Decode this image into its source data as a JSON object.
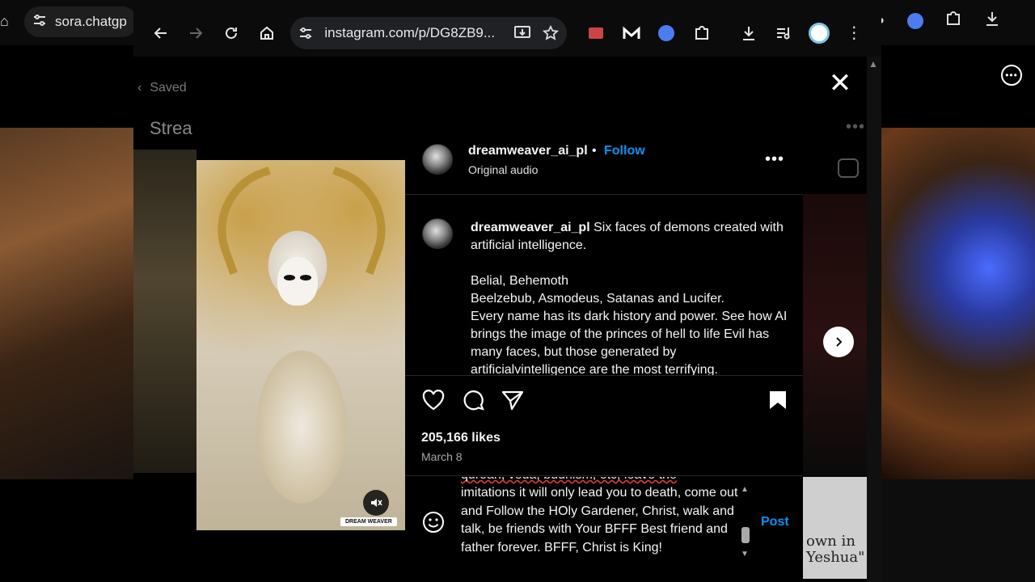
{
  "background_browser": {
    "tab_title": "sora.chatgp",
    "tab_icon": "tune-icon"
  },
  "browser": {
    "url": "instagram.com/p/DG8ZB9...",
    "buttons": [
      "back-icon",
      "forward-icon",
      "reload-icon",
      "home-icon"
    ],
    "extensions": [
      "install-app-icon",
      "bookmark-star-icon",
      "extension-icon",
      "m-extension-icon",
      "docs-icon",
      "puzzle-icon",
      "download-icon",
      "media-icon",
      "profile-icon",
      "menu-icon"
    ]
  },
  "page": {
    "saved_label": "Saved",
    "stream_title": "Strea"
  },
  "post": {
    "username": "dreamweaver_ai_pl",
    "separator": "•",
    "follow_label": "Follow",
    "audio_label": "Original audio",
    "caption_username": "dreamweaver_ai_pl",
    "caption_line1": " Six faces of demons created with artificial intelligence.",
    "caption_line2": "Belial, Behemoth",
    "caption_line3": "Beelzebub, Asmodeus, Satanas and Lucifer.",
    "caption_line4": "Every name has its dark history and power. See how AI brings the image of the princes of hell to life Evil has many faces, but those generated by artificialvintelligence are the most terrifying.",
    "likes": "205,166 likes",
    "date": "March 8",
    "watermark": "DREAM WEAVER",
    "comment_draft_line1": "quroan, veda, budhism, etc, leave the",
    "comment_draft_rest": "imitations it will only lead you to death, come out and Follow the HOly Gardener, Christ, walk and talk, be friends with Your BFFF Best friend and father forever. BFFF, Christ is King!",
    "post_button": "Post"
  },
  "background_card": {
    "text": "own in Yeshua\""
  },
  "colors": {
    "accent": "#0095f6",
    "background": "#000000",
    "text": "#f5f5f5",
    "muted": "#a8a8a8"
  }
}
